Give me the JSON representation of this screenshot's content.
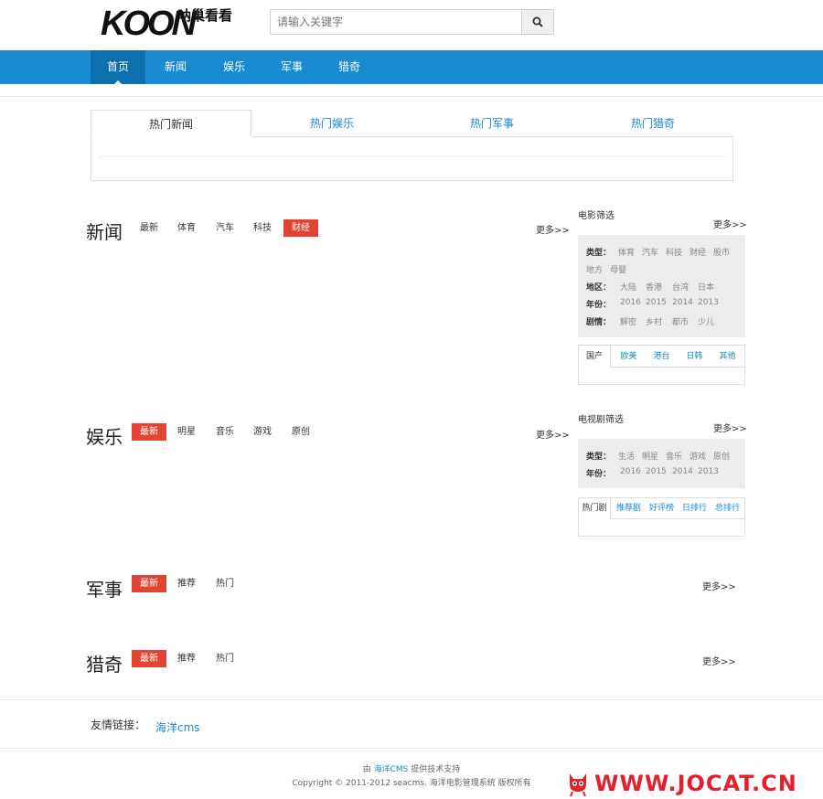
{
  "header": {
    "logo_text": "KOON",
    "logo_cn": "呐巢看看",
    "search_placeholder": "请输入关键字"
  },
  "nav": {
    "items": [
      {
        "label": "首页",
        "active": true
      },
      {
        "label": "新闻"
      },
      {
        "label": "娱乐"
      },
      {
        "label": "军事"
      },
      {
        "label": "猎奇"
      }
    ]
  },
  "hot_tabs": [
    "热门新闻",
    "热门娱乐",
    "热门军事",
    "热门猎奇"
  ],
  "sections": [
    {
      "title": "新闻",
      "tags": [
        "最新",
        "体育",
        "汽车",
        "科技",
        "财经"
      ],
      "active_tag": "财经",
      "more": "更多>>"
    },
    {
      "title": "娱乐",
      "tags": [
        "最新",
        "明星",
        "音乐",
        "游戏",
        "原创"
      ],
      "active_tag": "最新",
      "more": "更多>>"
    },
    {
      "title": "军事",
      "tags": [
        "最新",
        "推荐",
        "热门"
      ],
      "active_tag": "最新",
      "more": "更多>>"
    },
    {
      "title": "猎奇",
      "tags": [
        "最新",
        "推荐",
        "热门"
      ],
      "active_tag": "最新",
      "more": "更多>>"
    }
  ],
  "movie_filter": {
    "title": "电影筛选",
    "more": "更多>>",
    "type_label": "类型：",
    "types_row1": [
      "体育",
      "汽车",
      "科技",
      "财经",
      "股市"
    ],
    "types_row2": [
      "地方",
      "母婴"
    ],
    "region_label": "地区：",
    "regions": [
      "大陆",
      "香港",
      "台湾",
      "日本"
    ],
    "year_label": "年份：",
    "years": [
      "2016",
      "2015",
      "2014",
      "2013"
    ],
    "plot_label": "剧情：",
    "plots": [
      "解密",
      "乡村",
      "都市",
      "少儿"
    ],
    "tabs": [
      "国产",
      "欧美",
      "港台",
      "日韩",
      "其他"
    ]
  },
  "tv_filter": {
    "title": "电视剧筛选",
    "more": "更多>>",
    "type_label": "类型：",
    "types": [
      "生活",
      "明星",
      "音乐",
      "游戏",
      "原创"
    ],
    "year_label": "年份：",
    "years": [
      "2016",
      "2015",
      "2014",
      "2013"
    ],
    "tabs": [
      "热门剧",
      "推荐剧",
      "好评榜",
      "日排行",
      "总排行"
    ]
  },
  "footer": {
    "links_label": "友情链接：",
    "links": [
      "海洋cms"
    ],
    "line1_prefix": "由 ",
    "line1_link": "海洋CMS",
    "line1_suffix": " 提供技术支持",
    "line2": "Copyright © 2011-2012 seacms. 海洋电影管理系统 版权所有"
  },
  "watermark": "WWW.JOCAT.CN",
  "colors": {
    "nav_bg": "#1a8ad2",
    "nav_active": "#0e6fae",
    "tag_active": "#e24332",
    "link": "#1a8ad2",
    "watermark": "#e4202f"
  }
}
